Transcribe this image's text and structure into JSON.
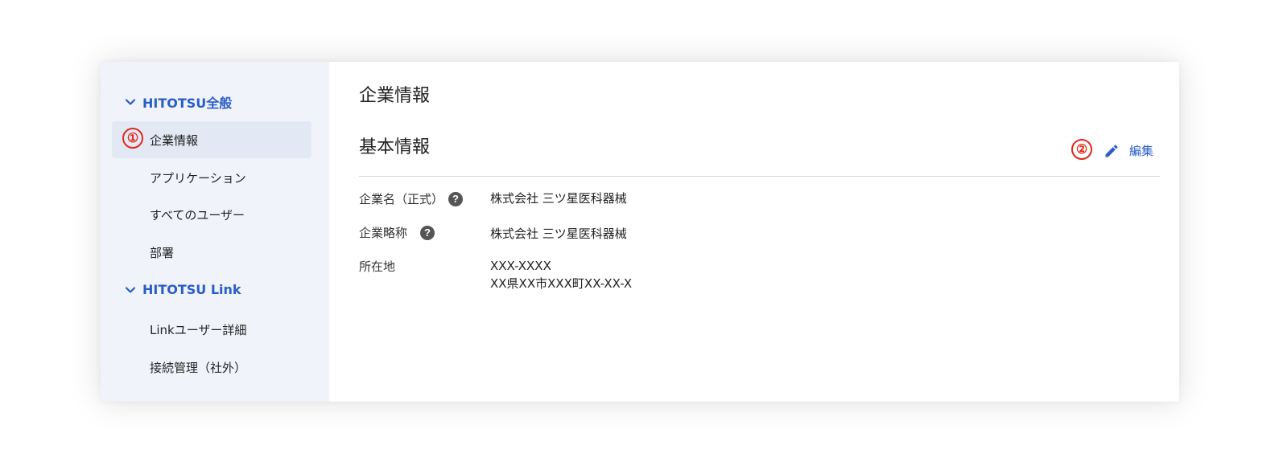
{
  "sidebar": {
    "sections": [
      {
        "label": "HITOTSU全般"
      },
      {
        "label": "HITOTSU Link"
      }
    ],
    "items": [
      {
        "label": "企業情報"
      },
      {
        "label": "アプリケーション"
      },
      {
        "label": "すべてのユーザー"
      },
      {
        "label": "部署"
      },
      {
        "label": "Linkユーザー詳細"
      },
      {
        "label": "接続管理（社外）"
      }
    ]
  },
  "markers": {
    "one": "①",
    "two": "②"
  },
  "main": {
    "page_title": "企業情報",
    "section_title": "基本情報",
    "edit_label": "編集",
    "fields": [
      {
        "label": "企業名（正式）",
        "value": "株式会社 三ツ星医科器械"
      },
      {
        "label": "企業略称",
        "value": "株式会社 三ツ星医科器械"
      },
      {
        "label": "所在地",
        "value_line1": "XXX-XXXX",
        "value_line2": "XX県XX市XXX町XX-XX-X"
      }
    ]
  },
  "colors": {
    "accent": "#2a5dc8",
    "marker": "#e0291a",
    "sidebar_bg": "#f0f4fa",
    "active_bg": "#e2e9f5"
  },
  "icons": [
    "chevron-down-icon",
    "pencil-icon",
    "help-icon"
  ]
}
